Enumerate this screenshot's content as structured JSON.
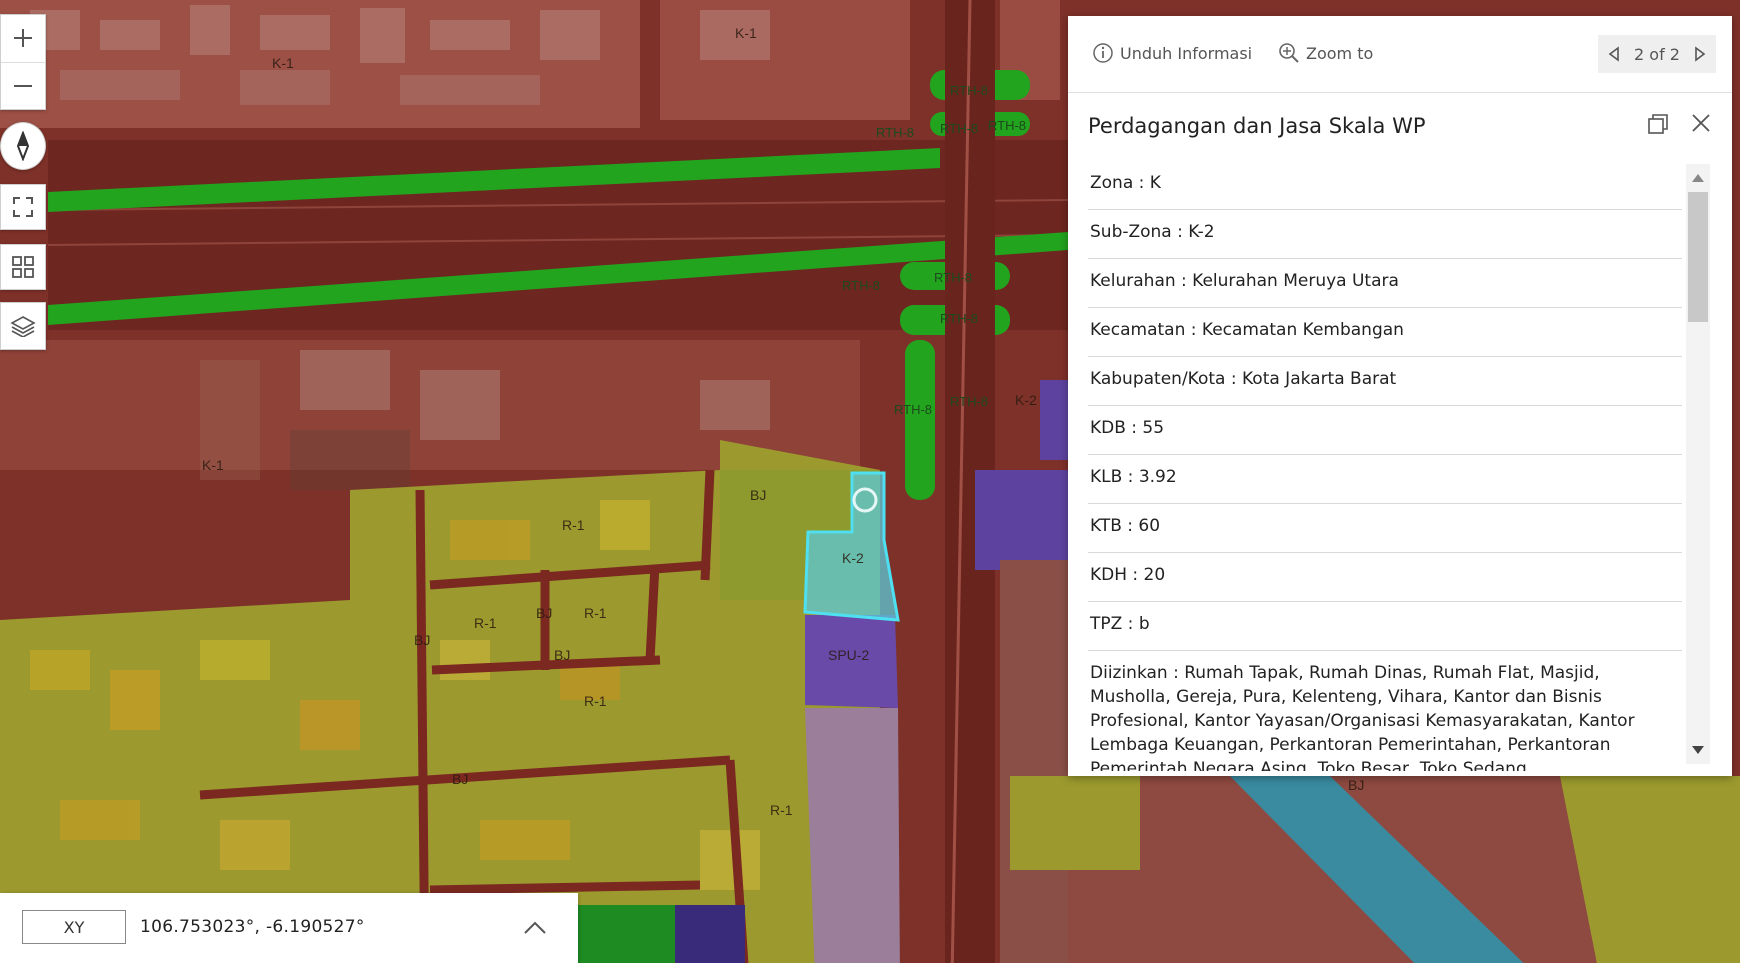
{
  "map": {
    "zone_labels": [
      "K-1",
      "K-1",
      "K-1",
      "RTH-8",
      "RTH-8",
      "RTH-8",
      "RTH-8",
      "RTH-8",
      "RTH-8",
      "RTH-8",
      "RTH-8",
      "RTH-8",
      "K-2",
      "BJ",
      "R-1",
      "BJ",
      "R-1",
      "R-1",
      "BJ",
      "BJ",
      "K-2",
      "SPU-2",
      "R-1",
      "BJ",
      "R-1",
      "BJ"
    ],
    "colors": {
      "road": "#7a2820",
      "commercial": "#8c3a30",
      "residential": "#9aa030",
      "green": "#22a41e",
      "public": "#6a4aa8",
      "water": "#3a8aa0",
      "selected": "#5cc8d8"
    }
  },
  "controls": {
    "zoom_in": "plus-icon",
    "zoom_out": "minus-icon",
    "compass": "compass-icon",
    "fullscreen": "fullscreen-icon",
    "basemap": "basemap-gallery-icon",
    "layers": "layers-icon"
  },
  "popup": {
    "download_label": "Unduh Informasi",
    "zoom_label": "Zoom to",
    "pager": "2 of 2",
    "title": "Perdagangan dan Jasa Skala WP",
    "attributes": [
      "Zona : K",
      "Sub-Zona : K-2",
      "Kelurahan : Kelurahan Meruya Utara",
      "Kecamatan : Kecamatan Kembangan",
      "Kabupaten/Kota : Kota Jakarta Barat",
      "KDB : 55",
      "KLB : 3.92",
      "KTB : 60",
      "KDH : 20",
      "TPZ : b"
    ],
    "permitted": "Diizinkan : Rumah Tapak, Rumah Dinas, Rumah Flat, Masjid, Musholla, Gereja, Pura, Kelenteng, Vihara, Kantor dan Bisnis Profesional, Kantor Yayasan/Organisasi Kemasyarakatan, Kantor Lembaga Keuangan, Perkantoran Pemerintahan, Perkantoran Pemerintah Negara Asing, Toko Besar, Toko Sedang"
  },
  "coords": {
    "mode": "XY",
    "value": "106.753023°, -6.190527°"
  }
}
